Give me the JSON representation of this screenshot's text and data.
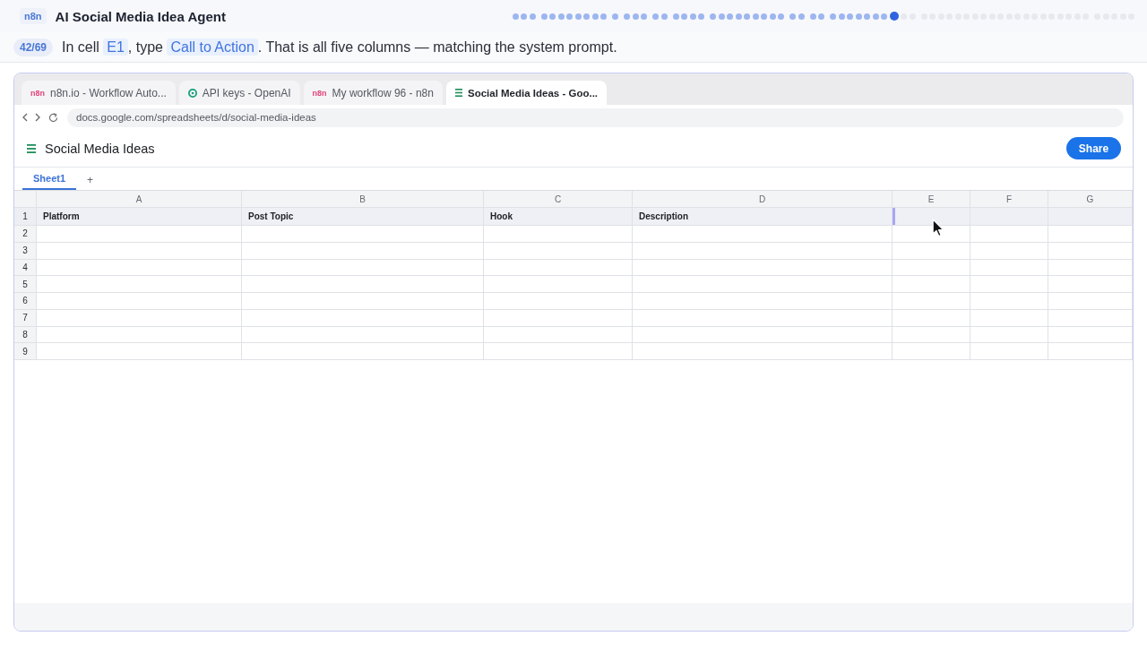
{
  "header": {
    "badge": "n8n",
    "title": "AI Social Media Idea Agent"
  },
  "progress": {
    "groups": [
      {
        "steps": [
          {
            "completed": true,
            "current": false
          },
          {
            "completed": true,
            "current": false
          },
          {
            "completed": true,
            "current": false
          }
        ]
      },
      {
        "steps": [
          {
            "completed": true,
            "current": false
          },
          {
            "completed": true,
            "current": false
          },
          {
            "completed": true,
            "current": false
          },
          {
            "completed": true,
            "current": false
          },
          {
            "completed": true,
            "current": false
          },
          {
            "completed": true,
            "current": false
          },
          {
            "completed": true,
            "current": false
          },
          {
            "completed": true,
            "current": false
          }
        ]
      },
      {
        "steps": [
          {
            "completed": true,
            "current": false
          }
        ]
      },
      {
        "steps": [
          {
            "completed": true,
            "current": false
          },
          {
            "completed": true,
            "current": false
          },
          {
            "completed": true,
            "current": false
          }
        ]
      },
      {
        "steps": [
          {
            "completed": true,
            "current": false
          },
          {
            "completed": true,
            "current": false
          }
        ]
      },
      {
        "steps": [
          {
            "completed": true,
            "current": false
          },
          {
            "completed": true,
            "current": false
          },
          {
            "completed": true,
            "current": false
          },
          {
            "completed": true,
            "current": false
          }
        ]
      },
      {
        "steps": [
          {
            "completed": true,
            "current": false
          },
          {
            "completed": true,
            "current": false
          },
          {
            "completed": true,
            "current": false
          },
          {
            "completed": true,
            "current": false
          },
          {
            "completed": true,
            "current": false
          },
          {
            "completed": true,
            "current": false
          },
          {
            "completed": true,
            "current": false
          },
          {
            "completed": true,
            "current": false
          },
          {
            "completed": true,
            "current": false
          }
        ]
      },
      {
        "steps": [
          {
            "completed": true,
            "current": false
          },
          {
            "completed": true,
            "current": false
          }
        ]
      },
      {
        "steps": [
          {
            "completed": true,
            "current": false
          },
          {
            "completed": true,
            "current": false
          }
        ]
      },
      {
        "steps": [
          {
            "completed": true,
            "current": false
          },
          {
            "completed": true,
            "current": false
          },
          {
            "completed": true,
            "current": false
          },
          {
            "completed": true,
            "current": false
          },
          {
            "completed": true,
            "current": false
          },
          {
            "completed": true,
            "current": false
          },
          {
            "completed": true,
            "current": false
          },
          {
            "completed": false,
            "current": true
          },
          {
            "completed": false,
            "current": false
          },
          {
            "completed": false,
            "current": false
          }
        ]
      },
      {
        "steps": [
          {
            "completed": false,
            "current": false
          },
          {
            "completed": false,
            "current": false
          },
          {
            "completed": false,
            "current": false
          },
          {
            "completed": false,
            "current": false
          },
          {
            "completed": false,
            "current": false
          },
          {
            "completed": false,
            "current": false
          },
          {
            "completed": false,
            "current": false
          },
          {
            "completed": false,
            "current": false
          },
          {
            "completed": false,
            "current": false
          },
          {
            "completed": false,
            "current": false
          },
          {
            "completed": false,
            "current": false
          },
          {
            "completed": false,
            "current": false
          },
          {
            "completed": false,
            "current": false
          },
          {
            "completed": false,
            "current": false
          },
          {
            "completed": false,
            "current": false
          },
          {
            "completed": false,
            "current": false
          },
          {
            "completed": false,
            "current": false
          },
          {
            "completed": false,
            "current": false
          },
          {
            "completed": false,
            "current": false
          },
          {
            "completed": false,
            "current": false
          }
        ]
      },
      {
        "steps": [
          {
            "completed": false,
            "current": false
          },
          {
            "completed": false,
            "current": false
          },
          {
            "completed": false,
            "current": false
          },
          {
            "completed": false,
            "current": false
          },
          {
            "completed": false,
            "current": false
          }
        ]
      }
    ]
  },
  "instruction": {
    "step": "42/69",
    "segments": [
      {
        "kind": "plain",
        "text": "In cell "
      },
      {
        "kind": "code",
        "text": "E1"
      },
      {
        "kind": "plain",
        "text": ", type "
      },
      {
        "kind": "code",
        "text": "Call to Action"
      },
      {
        "kind": "plain",
        "text": ". That is all five columns — matching the system prompt."
      }
    ]
  },
  "browser": {
    "tabs": [
      {
        "favicon": {
          "kind": "text",
          "text": "n8n"
        },
        "label": "n8n.io - Workflow Auto...",
        "selected": false
      },
      {
        "favicon": {
          "kind": "logo"
        },
        "label": "API keys - OpenAI",
        "selected": false
      },
      {
        "favicon": {
          "kind": "text",
          "text": "n8n"
        },
        "label": "My workflow 96 - n8n",
        "selected": false
      },
      {
        "favicon": {
          "kind": "sheet"
        },
        "label": "Social Media Ideas - Goo...",
        "selected": true
      }
    ],
    "url": "docs.google.com/spreadsheets/d/social-media-ideas"
  },
  "sheet": {
    "title": "Social Media Ideas",
    "share_button": "Share",
    "sheet_tabs": [
      {
        "label": "Sheet1",
        "selected": true
      }
    ],
    "add_sheet": "+",
    "table": {
      "columns": [
        "A",
        "B",
        "C",
        "D",
        "E",
        "F",
        "G"
      ],
      "rows": [
        {
          "number": "1",
          "cells": [
            {
              "text": "Platform",
              "selected": false
            },
            {
              "text": "Post Topic",
              "selected": false
            },
            {
              "text": "Hook",
              "selected": false
            },
            {
              "text": "Description",
              "selected": false
            },
            {
              "selected": true
            },
            {
              "selected": false
            },
            {
              "selected": false
            }
          ]
        },
        {
          "number": "2"
        },
        {
          "number": "3"
        },
        {
          "number": "4"
        },
        {
          "number": "5"
        },
        {
          "number": "6"
        },
        {
          "number": "7"
        },
        {
          "number": "8"
        },
        {
          "number": "9"
        }
      ]
    }
  }
}
